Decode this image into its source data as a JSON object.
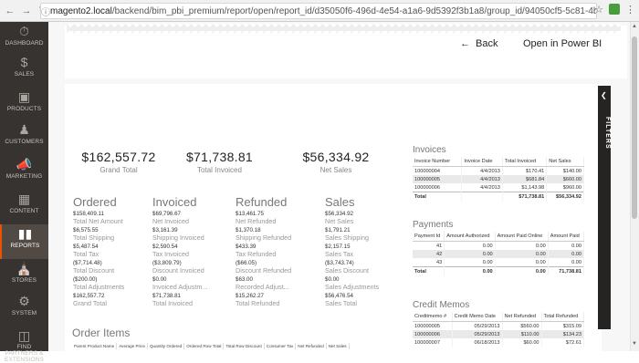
{
  "browser": {
    "url_host": "magento2.local",
    "url_path": "/backend/bim_pbi_premium/report/open/report_id/d35050f6-496d-4e54-a1a6-9d5392f3b1a8/group_id/94050cf5-5c81-4be8-84c9-cd95e6aa0677/key/..."
  },
  "sidebar": {
    "items": [
      {
        "label": "DASHBOARD",
        "icon": "dashboard-icon"
      },
      {
        "label": "SALES",
        "icon": "dollar-icon"
      },
      {
        "label": "PRODUCTS",
        "icon": "box-icon"
      },
      {
        "label": "CUSTOMERS",
        "icon": "person-icon"
      },
      {
        "label": "MARKETING",
        "icon": "megaphone-icon"
      },
      {
        "label": "CONTENT",
        "icon": "content-icon"
      },
      {
        "label": "REPORTS",
        "icon": "bar-chart-icon"
      },
      {
        "label": "STORES",
        "icon": "store-icon"
      },
      {
        "label": "SYSTEM",
        "icon": "gear-icon"
      },
      {
        "label": "FIND PARTNERS & EXTENSIONS",
        "icon": "puzzle-icon"
      }
    ],
    "active_index": 6
  },
  "header": {
    "back_label": "Back",
    "open_label": "Open in Power BI"
  },
  "filters_label": "FILTERS",
  "kpis": [
    {
      "value": "$162,557.72",
      "label": "Grand Total"
    },
    {
      "value": "$71,738.81",
      "label": "Total Invoiced"
    },
    {
      "value": "$56,334.92",
      "label": "Net Sales"
    }
  ],
  "summary": [
    {
      "title": "Ordered",
      "rows": [
        {
          "v": "$158,409.11",
          "l": "Total Net Amount"
        },
        {
          "v": "$6,575.55",
          "l": "Total Shipping"
        },
        {
          "v": "$5,487.54",
          "l": "Total Tax"
        },
        {
          "v": "($7,714.48)",
          "l": "Total Discount"
        },
        {
          "v": "($200.00)",
          "l": "Total Adjustments"
        },
        {
          "v": "$162,557.72",
          "l": "Grand Total"
        }
      ]
    },
    {
      "title": "Invoiced",
      "rows": [
        {
          "v": "$69,796.67",
          "l": "Net Invoiced"
        },
        {
          "v": "$3,161.39",
          "l": "Shipping Invoiced"
        },
        {
          "v": "$2,590.54",
          "l": "Tax Invoiced"
        },
        {
          "v": "($3,809.79)",
          "l": "Discount Invoiced"
        },
        {
          "v": "$0.00",
          "l": "Invoiced Adjustm..."
        },
        {
          "v": "$71,738.81",
          "l": "Total Invoiced"
        }
      ]
    },
    {
      "title": "Refunded",
      "rows": [
        {
          "v": "$13,461.75",
          "l": "Net Refunded"
        },
        {
          "v": "$1,370.18",
          "l": "Shipping Refunded"
        },
        {
          "v": "$433.39",
          "l": "Tax Refunded"
        },
        {
          "v": "($66.05)",
          "l": "Discount Refunded"
        },
        {
          "v": "$63.00",
          "l": "Recorded Adjust..."
        },
        {
          "v": "$15,262.27",
          "l": "Total Refunded"
        }
      ]
    },
    {
      "title": "Sales",
      "rows": [
        {
          "v": "$56,334.92",
          "l": "Net Sales"
        },
        {
          "v": "$1,791.21",
          "l": "Sales Shipping"
        },
        {
          "v": "$2,157.15",
          "l": "Sales Tax"
        },
        {
          "v": "($3,743.74)",
          "l": "Sales Discount"
        },
        {
          "v": "$0.00",
          "l": "Sales Adjustments"
        },
        {
          "v": "$56,476.54",
          "l": "Sales Total"
        }
      ]
    }
  ],
  "invoices": {
    "title": "Invoices",
    "columns": [
      "Invoice Number",
      "Invoice Date",
      "Total Invoiced",
      "Net Sales"
    ],
    "rows": [
      [
        "100000004",
        "4/4/2013",
        "$170.41",
        "$140.00"
      ],
      [
        "100000005",
        "4/4/2013",
        "$681.84",
        "$660.00"
      ],
      [
        "100000006",
        "4/4/2013",
        "$1,143.98",
        "$960.00"
      ]
    ],
    "total": [
      "Total",
      "",
      "$71,738.81",
      "$56,334.92"
    ]
  },
  "payments": {
    "title": "Payments",
    "columns": [
      "Payment Id",
      "Amount Authorized",
      "Amount Paid Online",
      "Amount Paid"
    ],
    "rows": [
      [
        "41",
        "0.00",
        "0.00",
        "0.00"
      ],
      [
        "42",
        "0.00",
        "0.00",
        "0.00"
      ],
      [
        "43",
        "0.00",
        "0.00",
        "0.00"
      ]
    ],
    "total": [
      "Total",
      "0.00",
      "0.00",
      "71,738.81"
    ]
  },
  "credit_memos": {
    "title": "Credit Memos",
    "columns": [
      "Creditmemo #",
      "Credit Memo Date",
      "Net Refunded",
      "Total Refunded"
    ],
    "rows": [
      [
        "100000005",
        "05/29/2013",
        "$560.00",
        "$315.09"
      ],
      [
        "100000006",
        "05/29/2013",
        "$110.00",
        "$134.23"
      ],
      [
        "100000007",
        "06/18/2013",
        "$60.00",
        "$72.61"
      ]
    ]
  },
  "order_items": {
    "title": "Order Items",
    "columns": [
      "Parent Product Name",
      "Average Price",
      "Quantity Ordered",
      "Ordered Row Total",
      "Total Row Discount",
      "Consumer Tax",
      "Net Refunded",
      "Net Sales"
    ]
  }
}
